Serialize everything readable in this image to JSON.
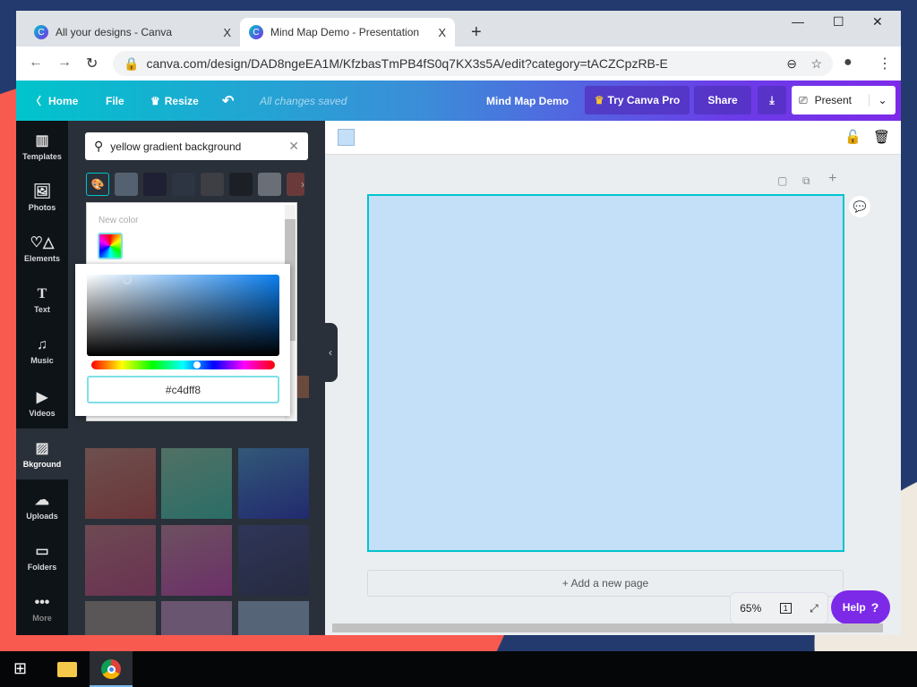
{
  "browser": {
    "tabs": [
      {
        "label": "All your designs - Canva",
        "close": "X"
      },
      {
        "label": "Mind Map Demo - Presentation",
        "close": "X"
      }
    ],
    "new_tab": "+",
    "url": "canva.com/design/DAD8ngeEA1M/KfzbasTmPB4fS0q7KX3s5A/edit?category=tACZCpzRB-E",
    "favicon": "C"
  },
  "header": {
    "home": "Home",
    "file": "File",
    "resize": "Resize",
    "status": "All changes saved",
    "title": "Mind Map Demo",
    "try_pro": "Try Canva Pro",
    "share": "Share",
    "present": "Present"
  },
  "sidebar": {
    "items": [
      {
        "label": "Templates",
        "icon": "▥"
      },
      {
        "label": "Photos",
        "icon": "🖼"
      },
      {
        "label": "Elements",
        "icon": "♡△"
      },
      {
        "label": "Text",
        "icon": "T"
      },
      {
        "label": "Music",
        "icon": "♫"
      },
      {
        "label": "Videos",
        "icon": "▶"
      },
      {
        "label": "Bkground",
        "icon": "▨"
      },
      {
        "label": "Uploads",
        "icon": "☁"
      },
      {
        "label": "Folders",
        "icon": "▭"
      },
      {
        "label": "More",
        "icon": "•••"
      }
    ]
  },
  "panel": {
    "search_value": "yellow gradient background",
    "new_color_label": "New color",
    "hex_value": "#c4dff8"
  },
  "canvas": {
    "add_page": "+ Add a new page",
    "zoom": "65%",
    "page_count": "1",
    "help": "Help",
    "page_color": "#c4dff8"
  }
}
